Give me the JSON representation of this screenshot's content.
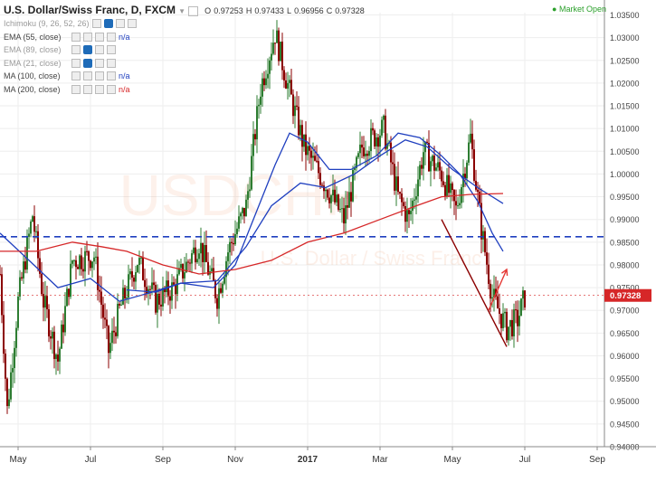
{
  "header": {
    "symbol": "U.S. Dollar/Swiss Franc, D, FXCM",
    "o_label": "O",
    "o_value": "0.97253",
    "h_label": "H",
    "h_value": "0.97433",
    "l_label": "L",
    "l_value": "0.96956",
    "c_label": "C",
    "c_value": "0.97328",
    "market_status": "Market Open",
    "market_status_color": "#2ca02c"
  },
  "indicators": [
    {
      "label": "Ichimoku (9, 26, 52, 26)",
      "value": "",
      "value_color": "#1f3fbf",
      "faded": true
    },
    {
      "label": "EMA (55, close)",
      "value": "n/a",
      "value_color": "#1f3fbf",
      "faded": false
    },
    {
      "label": "EMA (89, close)",
      "value": "",
      "value_color": "#1f3fbf",
      "faded": true
    },
    {
      "label": "EMA (21, close)",
      "value": "",
      "value_color": "#1f3fbf",
      "faded": true
    },
    {
      "label": "MA (100, close)",
      "value": "n/a",
      "value_color": "#1f3fbf",
      "faded": false
    },
    {
      "label": "MA (200, close)",
      "value": "n/a",
      "value_color": "#d62728",
      "faded": false
    }
  ],
  "watermark": {
    "line1": "USDCHF",
    "line2": "U.S. Dollar / Swiss Franc"
  },
  "chart_data": {
    "type": "line",
    "chart_style": "candlestick",
    "ylim": [
      0.94,
      1.0355
    ],
    "y_ticks": [
      "1.03500",
      "1.03000",
      "1.02500",
      "1.02000",
      "1.01500",
      "1.01000",
      "1.00500",
      "1.00000",
      "0.99500",
      "0.99000",
      "0.98500",
      "0.98000",
      "0.97500",
      "0.97000",
      "0.96500",
      "0.96000",
      "0.95500",
      "0.95000",
      "0.94500",
      "0.94000"
    ],
    "x_tick_labels": [
      "May",
      "Jul",
      "Sep",
      "Nov",
      "2017",
      "Mar",
      "May",
      "Jul",
      "Sep"
    ],
    "last_price": "0.97328",
    "last_price_value": 0.97328,
    "colors": {
      "up": "#2e7d32",
      "down": "#8b0000",
      "ema55": "#1f3fbf",
      "ma100": "#1f3fbf",
      "ma200": "#d62728",
      "hline": "#1f3fbf",
      "trend": "#8b0000",
      "last_price_bg": "#d62728"
    },
    "price_path": [
      {
        "m": 0,
        "v": 0.978
      },
      {
        "m": 0.2,
        "v": 0.948
      },
      {
        "m": 0.5,
        "v": 0.972
      },
      {
        "m": 0.9,
        "v": 0.991
      },
      {
        "m": 1.2,
        "v": 0.972
      },
      {
        "m": 1.6,
        "v": 0.959
      },
      {
        "m": 2.0,
        "v": 0.981
      },
      {
        "m": 2.6,
        "v": 0.982
      },
      {
        "m": 3.0,
        "v": 0.961
      },
      {
        "m": 3.3,
        "v": 0.97
      },
      {
        "m": 3.8,
        "v": 0.981
      },
      {
        "m": 4.3,
        "v": 0.972
      },
      {
        "m": 4.8,
        "v": 0.975
      },
      {
        "m": 5.5,
        "v": 0.985
      },
      {
        "m": 6.0,
        "v": 0.973
      },
      {
        "m": 6.3,
        "v": 0.983
      },
      {
        "m": 6.8,
        "v": 0.993
      },
      {
        "m": 7.2,
        "v": 1.019
      },
      {
        "m": 7.6,
        "v": 1.031
      },
      {
        "m": 8.0,
        "v": 1.018
      },
      {
        "m": 8.4,
        "v": 1.006
      },
      {
        "m": 8.9,
        "v": 0.999
      },
      {
        "m": 9.5,
        "v": 0.99
      },
      {
        "m": 10.0,
        "v": 1.006
      },
      {
        "m": 10.6,
        "v": 1.01
      },
      {
        "m": 11.0,
        "v": 0.995
      },
      {
        "m": 11.3,
        "v": 0.99
      },
      {
        "m": 11.7,
        "v": 1.005
      },
      {
        "m": 12.2,
        "v": 1.0
      },
      {
        "m": 12.6,
        "v": 0.992
      },
      {
        "m": 13.0,
        "v": 1.008
      },
      {
        "m": 13.3,
        "v": 0.988
      },
      {
        "m": 13.6,
        "v": 0.973
      },
      {
        "m": 14.0,
        "v": 0.966
      },
      {
        "m": 14.3,
        "v": 0.968
      },
      {
        "m": 14.5,
        "v": 0.973
      }
    ],
    "series": [
      {
        "name": "EMA (55, close)",
        "values": [
          {
            "m": 0,
            "v": 0.987
          },
          {
            "m": 0.8,
            "v": 0.981
          },
          {
            "m": 1.6,
            "v": 0.975
          },
          {
            "m": 2.5,
            "v": 0.977
          },
          {
            "m": 3.3,
            "v": 0.972
          },
          {
            "m": 4.2,
            "v": 0.974
          },
          {
            "m": 5.0,
            "v": 0.976
          },
          {
            "m": 5.9,
            "v": 0.975
          },
          {
            "m": 6.5,
            "v": 0.98
          },
          {
            "m": 7.0,
            "v": 0.99
          },
          {
            "m": 7.6,
            "v": 1.002
          },
          {
            "m": 8.0,
            "v": 1.009
          },
          {
            "m": 8.5,
            "v": 1.007
          },
          {
            "m": 9.1,
            "v": 1.001
          },
          {
            "m": 9.7,
            "v": 1.001
          },
          {
            "m": 10.4,
            "v": 1.004
          },
          {
            "m": 11.0,
            "v": 1.009
          },
          {
            "m": 11.6,
            "v": 1.008
          },
          {
            "m": 12.2,
            "v": 1.004
          },
          {
            "m": 12.7,
            "v": 1.0
          },
          {
            "m": 13.2,
            "v": 0.994
          },
          {
            "m": 13.6,
            "v": 0.987
          },
          {
            "m": 13.9,
            "v": 0.983
          }
        ]
      },
      {
        "name": "MA (100, close)",
        "values": [
          {
            "m": 3.5,
            "v": 0.9745
          },
          {
            "m": 4.3,
            "v": 0.974
          },
          {
            "m": 5.0,
            "v": 0.976
          },
          {
            "m": 6.0,
            "v": 0.9765
          },
          {
            "m": 6.8,
            "v": 0.984
          },
          {
            "m": 7.5,
            "v": 0.993
          },
          {
            "m": 8.3,
            "v": 0.998
          },
          {
            "m": 9.0,
            "v": 0.997
          },
          {
            "m": 9.8,
            "v": 1.0
          },
          {
            "m": 10.5,
            "v": 1.004
          },
          {
            "m": 11.2,
            "v": 1.0075
          },
          {
            "m": 11.8,
            "v": 1.006
          },
          {
            "m": 12.5,
            "v": 1.001
          },
          {
            "m": 13.2,
            "v": 0.997
          },
          {
            "m": 13.9,
            "v": 0.9935
          }
        ]
      },
      {
        "name": "MA (200, close)",
        "values": [
          {
            "m": 0,
            "v": 0.983
          },
          {
            "m": 1.0,
            "v": 0.983
          },
          {
            "m": 2.0,
            "v": 0.985
          },
          {
            "m": 2.8,
            "v": 0.984
          },
          {
            "m": 3.5,
            "v": 0.983
          },
          {
            "m": 4.5,
            "v": 0.98
          },
          {
            "m": 5.5,
            "v": 0.978
          },
          {
            "m": 6.5,
            "v": 0.979
          },
          {
            "m": 7.5,
            "v": 0.981
          },
          {
            "m": 8.5,
            "v": 0.985
          },
          {
            "m": 9.5,
            "v": 0.987
          },
          {
            "m": 10.5,
            "v": 0.99
          },
          {
            "m": 11.5,
            "v": 0.993
          },
          {
            "m": 12.2,
            "v": 0.995
          },
          {
            "m": 13.0,
            "v": 0.9955
          },
          {
            "m": 13.9,
            "v": 0.9957
          }
        ]
      }
    ],
    "horizontal_level": 0.9862,
    "trendline": [
      {
        "m": 12.2,
        "v": 0.99
      },
      {
        "m": 14.0,
        "v": 0.962
      }
    ],
    "projection_arrow": [
      {
        "m": 13.5,
        "v": 0.97
      },
      {
        "m": 14.0,
        "v": 0.979
      }
    ]
  }
}
